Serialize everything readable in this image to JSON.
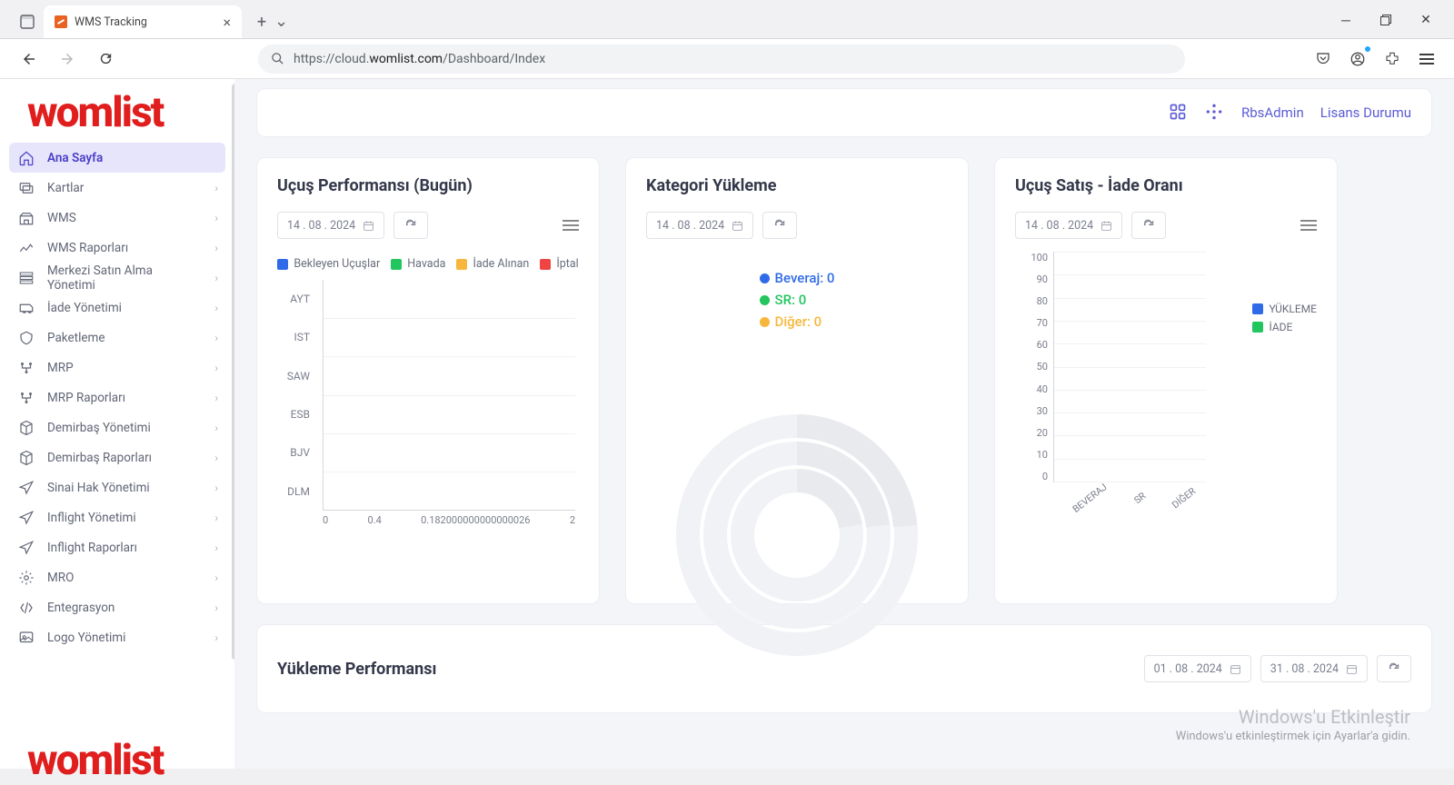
{
  "browser": {
    "tab_title": "WMS Tracking",
    "url_prefix": "https://cloud.",
    "url_bold": "womlist.com",
    "url_suffix": "/Dashboard/Index"
  },
  "logo": "womlist",
  "sidebar": {
    "items": [
      {
        "label": "Ana Sayfa",
        "active": true,
        "expandable": false
      },
      {
        "label": "Kartlar"
      },
      {
        "label": "WMS"
      },
      {
        "label": "WMS Raporları"
      },
      {
        "label": "Merkezi Satın Alma Yönetimi"
      },
      {
        "label": "İade Yönetimi"
      },
      {
        "label": "Paketleme"
      },
      {
        "label": "MRP"
      },
      {
        "label": "MRP Raporları"
      },
      {
        "label": "Demirbaş Yönetimi"
      },
      {
        "label": "Demirbaş Raporları"
      },
      {
        "label": "Sinai Hak Yönetimi"
      },
      {
        "label": "Inflight Yönetimi"
      },
      {
        "label": "Inflight Raporları"
      },
      {
        "label": "MRO"
      },
      {
        "label": "Entegrasyon"
      },
      {
        "label": "Logo Yönetimi"
      }
    ]
  },
  "topbar": {
    "user": "RbsAdmin",
    "license": "Lisans Durumu"
  },
  "cards": {
    "c1": {
      "title": "Uçuş Performansı (Bugün)",
      "date": "14 . 08 . 2024",
      "legend": [
        "Bekleyen Uçuşlar",
        "Havada",
        "İade Alınan",
        "İptal"
      ],
      "legend_colors": [
        "#2f6be8",
        "#22c55e",
        "#f6b73c",
        "#ef4444"
      ]
    },
    "c2": {
      "title": "Kategori Yükleme",
      "date": "14 . 08 . 2024",
      "legend": [
        {
          "label": "Beveraj: 0",
          "color": "#2f6be8"
        },
        {
          "label": "SR: 0",
          "color": "#22c55e"
        },
        {
          "label": "Diğer: 0",
          "color": "#f6b73c"
        }
      ]
    },
    "c3": {
      "title": "Uçuş Satış - İade Oranı",
      "date": "14 . 08 . 2024",
      "legend": [
        {
          "label": "YÜKLEME",
          "color": "#2f6be8"
        },
        {
          "label": "İADE",
          "color": "#22c55e"
        }
      ]
    },
    "c4": {
      "title": "Yükleme Performansı",
      "date_from": "01 . 08 . 2024",
      "date_to": "31 . 08 . 2024"
    }
  },
  "chart_data": [
    {
      "type": "bar",
      "orientation": "horizontal",
      "title": "Uçuş Performansı (Bugün)",
      "categories": [
        "AYT",
        "IST",
        "SAW",
        "ESB",
        "BJV",
        "DLM"
      ],
      "series": [
        {
          "name": "Bekleyen Uçuşlar",
          "values": [
            0,
            0,
            0,
            0,
            0,
            0
          ]
        },
        {
          "name": "Havada",
          "values": [
            0,
            0,
            0,
            0,
            0,
            0
          ]
        },
        {
          "name": "İade Alınan",
          "values": [
            0,
            0,
            0,
            0,
            0,
            0
          ]
        },
        {
          "name": "İptal",
          "values": [
            0,
            0,
            0,
            0,
            0,
            0
          ]
        }
      ],
      "x_ticks_raw": [
        "0",
        "0.4",
        "0.182000000000000026",
        "2"
      ],
      "xlim": [
        0,
        2
      ]
    },
    {
      "type": "pie",
      "title": "Kategori Yükleme",
      "slices": [
        {
          "name": "Beveraj",
          "value": 0
        },
        {
          "name": "SR",
          "value": 0
        },
        {
          "name": "Diğer",
          "value": 0
        }
      ]
    },
    {
      "type": "bar",
      "title": "Uçuş Satış - İade Oranı",
      "categories": [
        "BEVERAJ",
        "SR",
        "DİĞER"
      ],
      "series": [
        {
          "name": "YÜKLEME",
          "values": [
            0,
            0,
            0
          ]
        },
        {
          "name": "İADE",
          "values": [
            0,
            0,
            0
          ]
        }
      ],
      "y_ticks": [
        0,
        10,
        20,
        30,
        40,
        50,
        60,
        70,
        80,
        90,
        100
      ],
      "ylim": [
        0,
        100
      ]
    }
  ],
  "watermark": {
    "line1": "Windows'u Etkinleştir",
    "line2": "Windows'u etkinleştirmek için Ayarlar'a gidin."
  }
}
